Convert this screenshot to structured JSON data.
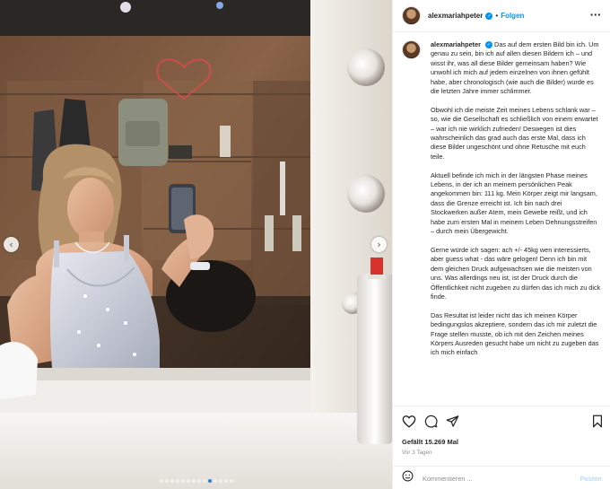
{
  "post": {
    "username": "alexmariahpeter",
    "follow_label": "Folgen",
    "separator": "•",
    "more_icon": "more-horizontal-icon",
    "verified_icon": "verified-badge-icon"
  },
  "caption": {
    "username": "alexmariahpeter",
    "paragraphs": [
      "Das auf dem ersten Bild bin ich. Um genau zu sein, bin ich auf allen diesen Bildern ich – und wisst ihr, was all diese Bilder gemeinsam haben? Wie unwohl ich mich auf jedem einzelnen von ihnen gefühlt habe, aber chronologisch (wie auch die Bilder) wurde es die letzten Jahre immer schlimmer.",
      "Obwohl ich die meiste Zeit meines Lebens schlank war – so, wie die Gesellschaft es schließlich von einem erwartet – war ich nie wirklich zufrieden! Deswegen ist dies wahrscheinlich das grad auch das erste Mal, dass ich diese Bilder ungeschönt und ohne Retusche mit euch teile.",
      "Aktuell befinde ich mich in der längsten Phase meines Lebens, in der ich an meinem persönlichen Peak angekommen bin: 111 kg. Mein Körper zeigt mir langsam, dass die Grenze erreicht ist. Ich bin nach drei Stockwerken außer Atem, mein Gewebe reißt, und ich habe zum ersten Mal in meinem Leben Dehnungsstreifen – durch mein Übergewicht.",
      "Gerne würde ich sagen: ach +/- 45kg wen interessierts, aber guess what - das wäre gelogen! Denn ich bin mit dem gleichen Druck aufgewachsen wie die meisten von uns. Was allerdings neu ist, ist der Druck durch die Öffentlichkeit nicht zugeben zu dürfen das ich mich zu dick finde.",
      "Das Resultat ist leider nicht das ich meinen Körper bedingungslos akzeptiere, sondern das ich mir zuletzt die Frage stellen musste, ob ich mit den Zeichen meines Körpers Ausreden gesucht habe um nicht zu zugeben das ich mich einfach"
    ]
  },
  "actions": {
    "like_icon": "heart-icon",
    "comment_icon": "comment-icon",
    "share_icon": "share-icon",
    "save_icon": "bookmark-icon",
    "likes_text": "Gefällt 15.269 Mal",
    "date_text": "Vor 3 Tagen"
  },
  "comment": {
    "emoji_icon": "emoji-icon",
    "placeholder": "Kommentieren ...",
    "post_label": "Posten"
  },
  "carousel": {
    "prev_icon": "chevron-left-icon",
    "next_icon": "chevron-right-icon",
    "prev_glyph": "‹",
    "next_glyph": "›",
    "slide_count": 14,
    "active_index": 9
  },
  "colors": {
    "accent": "#0095f6",
    "secondary_text": "#8e8e8e",
    "post_button_disabled": "#b3dbff",
    "active_dot": "#3a7bd5"
  }
}
